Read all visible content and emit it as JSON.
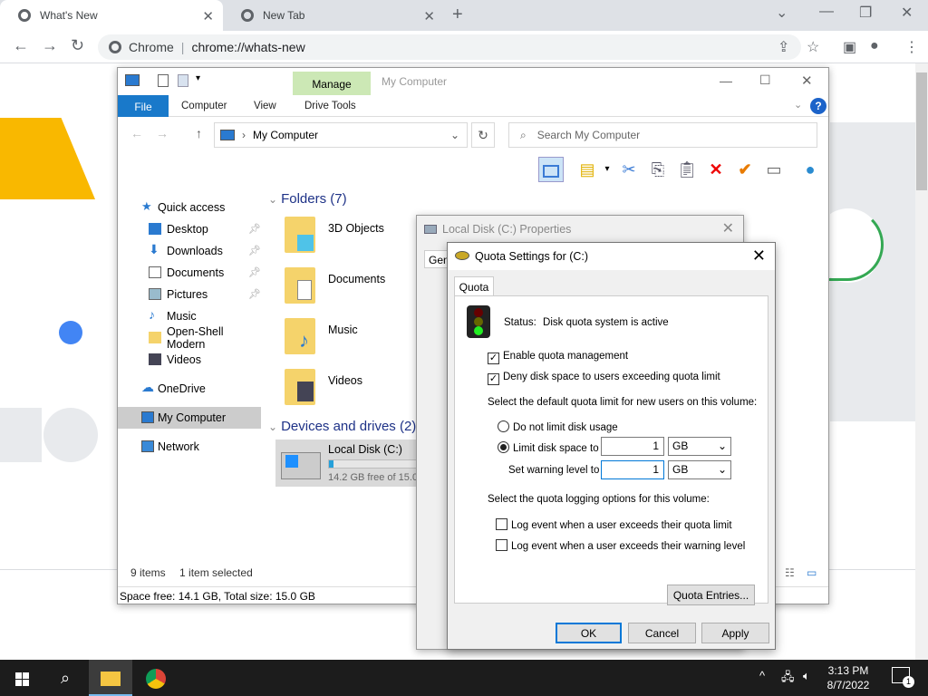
{
  "chrome": {
    "tabs": [
      {
        "label": "What's New",
        "active": true
      },
      {
        "label": "New Tab",
        "active": false
      }
    ],
    "omnibox": {
      "site": "Chrome",
      "url": "chrome://whats-new"
    }
  },
  "explorer": {
    "title": "My Computer",
    "contextual_tab": "Manage",
    "ribbon_tabs": [
      "File",
      "Computer",
      "View",
      "Drive Tools"
    ],
    "address": "My Computer",
    "search_placeholder": "Search My Computer",
    "nav": {
      "quick_access": "Quick access",
      "items": [
        "Desktop",
        "Downloads",
        "Documents",
        "Pictures",
        "Music",
        "Open-Shell Modern",
        "Videos"
      ],
      "onedrive": "OneDrive",
      "my_computer": "My Computer",
      "network": "Network"
    },
    "folders_header": "Folders (7)",
    "folders": [
      "3D Objects",
      "Documents",
      "Music",
      "Videos"
    ],
    "devices_header": "Devices and drives (2)",
    "drive": {
      "name": "Local Disk (C:)",
      "free": "14.2 GB free of 15.0",
      "used_fraction": 0.05
    },
    "status_items": "9 items",
    "status_selected": "1 item selected",
    "status_space": "Space free: 14.1 GB, Total size: 15.0 GB"
  },
  "properties": {
    "title": "Local Disk (C:) Properties",
    "tab": "General"
  },
  "quota": {
    "title": "Quota Settings for  (C:)",
    "tab": "Quota",
    "status_label": "Status:",
    "status_value": "Disk quota system is active",
    "enable_label": "Enable quota management",
    "deny_label": "Deny disk space to users exceeding quota limit",
    "default_limit_label": "Select the default quota limit for new users on this volume:",
    "no_limit_label": "Do not limit disk usage",
    "limit_label": "Limit disk space to",
    "limit_value": "1",
    "limit_unit": "GB",
    "warning_label": "Set warning level to",
    "warning_value": "1",
    "warning_unit": "GB",
    "logging_label": "Select the quota logging options for this volume:",
    "log_quota_label": "Log event when a user exceeds their quota limit",
    "log_warning_label": "Log event when a user exceeds their warning level",
    "entries_button": "Quota Entries...",
    "ok": "OK",
    "cancel": "Cancel",
    "apply": "Apply"
  },
  "taskbar": {
    "time": "3:13 PM",
    "date": "8/7/2022",
    "notification_count": "1"
  }
}
